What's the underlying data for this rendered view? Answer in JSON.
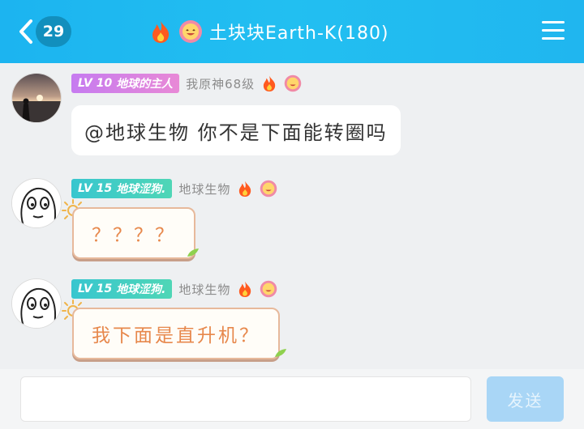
{
  "header": {
    "unread_count": "29",
    "title": "土块块Earth-K(180)"
  },
  "messages": [
    {
      "level": "LV 10",
      "title_badge": "地球的主人",
      "username": "我原神68级",
      "text": "@地球生物 你不是下面能转圈吗",
      "style": "plain"
    },
    {
      "level": "LV 15",
      "title_badge": "地球涩狗.",
      "username": "地球生物",
      "text": "？？？？",
      "style": "decorated"
    },
    {
      "level": "LV 15",
      "title_badge": "地球涩狗.",
      "username": "地球生物",
      "text": "我下面是直升机？",
      "style": "decorated"
    }
  ],
  "composer": {
    "input_value": "",
    "send_label": "发送"
  },
  "colors": {
    "header": "#1cb4f0",
    "badge_pink": "#d684e6",
    "badge_teal": "#3fcbc6",
    "bubble_text_orange": "#e7884c",
    "send_disabled": "#a9d6f6"
  }
}
